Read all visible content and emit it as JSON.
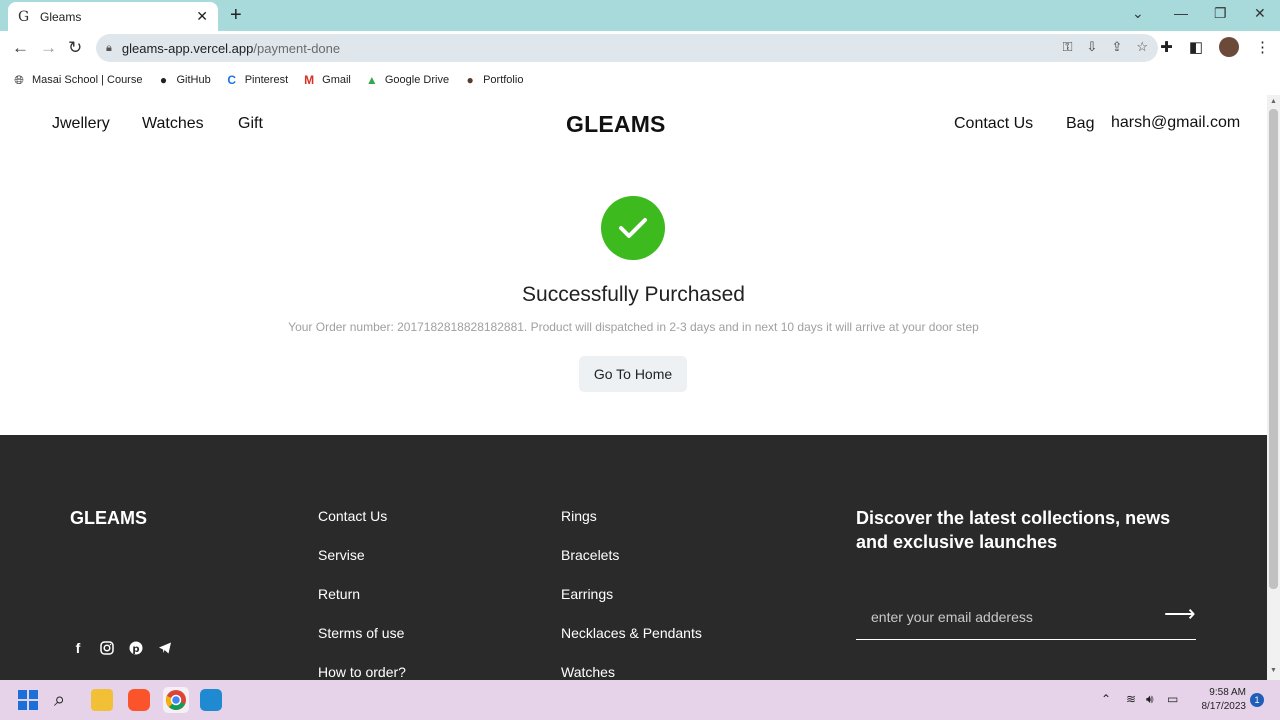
{
  "browser": {
    "tab_title": "Gleams",
    "tab_favicon": "G",
    "url_host": "gleams-app.vercel.app",
    "url_path": "/payment-done",
    "bookmarks": [
      {
        "label": "Masai School | Course",
        "icon": "globe-icon"
      },
      {
        "label": "GitHub",
        "icon": "github-icon"
      },
      {
        "label": "Pinterest",
        "icon": "pinterest-icon"
      },
      {
        "label": "Gmail",
        "icon": "gmail-icon"
      },
      {
        "label": "Google Drive",
        "icon": "drive-icon"
      },
      {
        "label": "Portfolio",
        "icon": "portfolio-icon"
      }
    ]
  },
  "nav": {
    "left": [
      "Jwellery",
      "Watches",
      "Gift"
    ],
    "brand": "GLEAMS",
    "contact": "Contact Us",
    "bag": "Bag",
    "user": "harsh@gmail.com"
  },
  "success": {
    "title": "Successfully Purchased",
    "message": "Your Order number: 2017182818828182881. Product will dispatched in 2-3 days and in next 10 days it will arrive at your door step",
    "button": "Go To Home",
    "check_color": "#3cba1e"
  },
  "footer": {
    "brand": "GLEAMS",
    "col1": [
      "Contact Us",
      "Servise",
      "Return",
      "Sterms of use",
      "How to order?"
    ],
    "col2": [
      "Rings",
      "Bracelets",
      "Earrings",
      "Necklaces & Pendants",
      "Watches"
    ],
    "newsletter_heading": "Discover the latest collections, news and exclusive launches",
    "email_placeholder": "enter your email adderess",
    "bg_color": "#2b2a2a"
  },
  "taskbar": {
    "time": "9:58 AM",
    "date": "8/17/2023",
    "notification_count": "1"
  }
}
